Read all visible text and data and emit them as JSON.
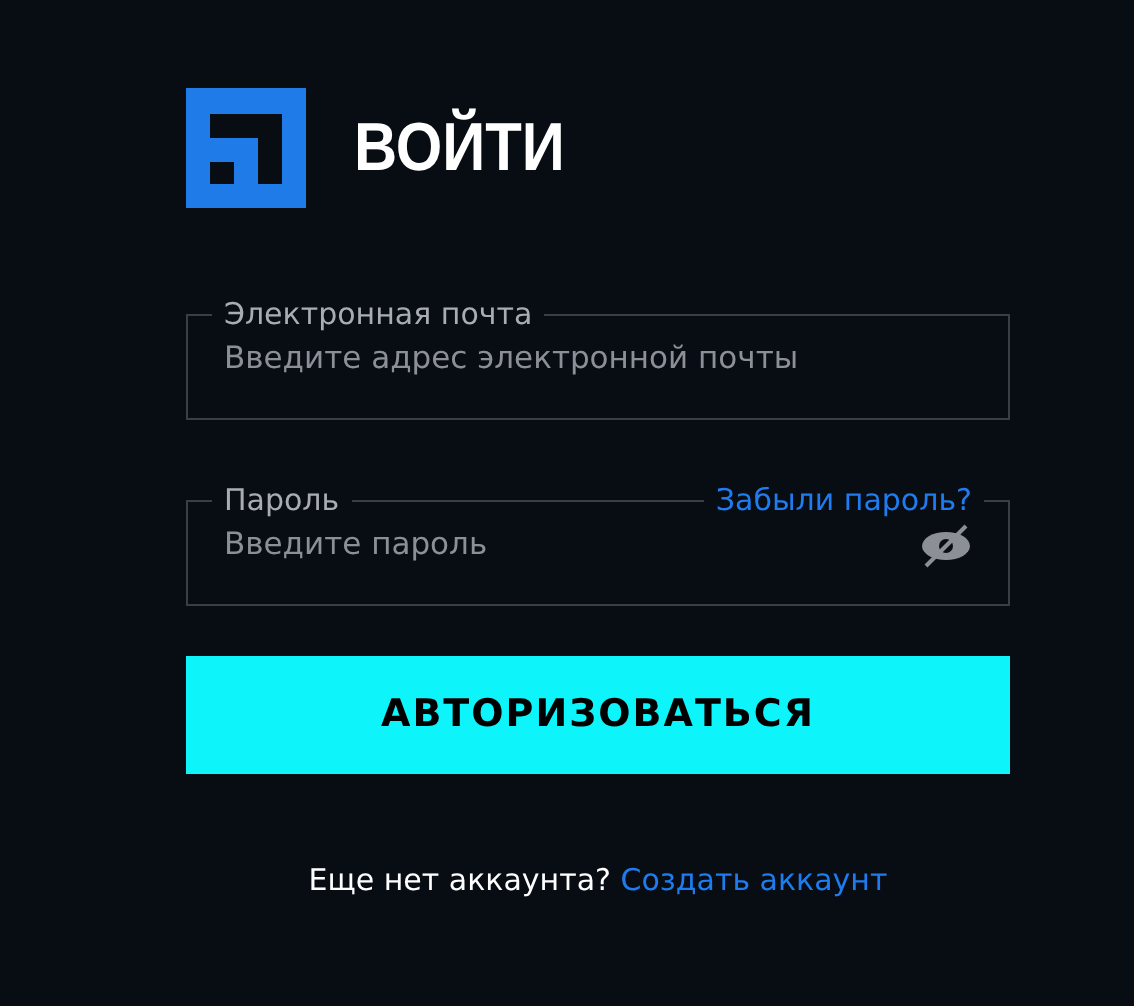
{
  "header": {
    "title": "ВОЙТИ"
  },
  "fields": [
    {
      "label": "Электронная почта",
      "placeholder": "Введите адрес электронной почты",
      "kind": "email"
    },
    {
      "label": "Пароль",
      "placeholder": "Введите пароль",
      "kind": "password",
      "link": "Забыли пароль?"
    }
  ],
  "submit": "АВТОРИЗОВАТЬСЯ",
  "footer": {
    "text": "Еще нет аккаунта?",
    "link": "Создать аккаунт"
  }
}
